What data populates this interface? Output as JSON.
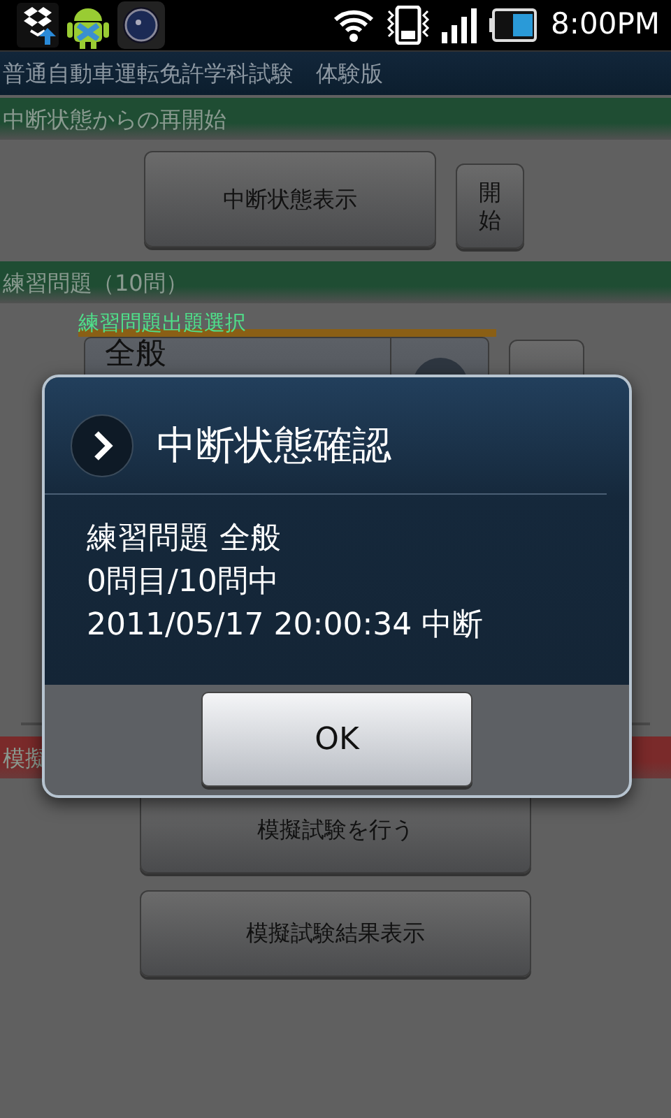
{
  "status_bar": {
    "time": "8:00PM"
  },
  "app_title": "普通自動車運転免許学科試験　体験版",
  "sections": [
    {
      "kind": "resume",
      "header": "中断状態からの再開始",
      "color": "#1f4d33",
      "buttons": [
        "中断状態表示",
        "開始"
      ]
    },
    {
      "kind": "practice",
      "header": "練習問題（10問）",
      "color": "#1f4d33",
      "select_label": "練習問題出題選択",
      "spinner_value": "全般"
    },
    {
      "kind": "exam",
      "header": "模擬",
      "color": "#7a2a2a",
      "buttons": [
        "模擬試験を行う",
        "模擬試験結果表示"
      ]
    }
  ],
  "dialog": {
    "title": "中断状態確認",
    "lines": [
      "練習問題 全般",
      "0問目/10問中",
      "2011/05/17 20:00:34 中断"
    ],
    "button": "OK"
  }
}
